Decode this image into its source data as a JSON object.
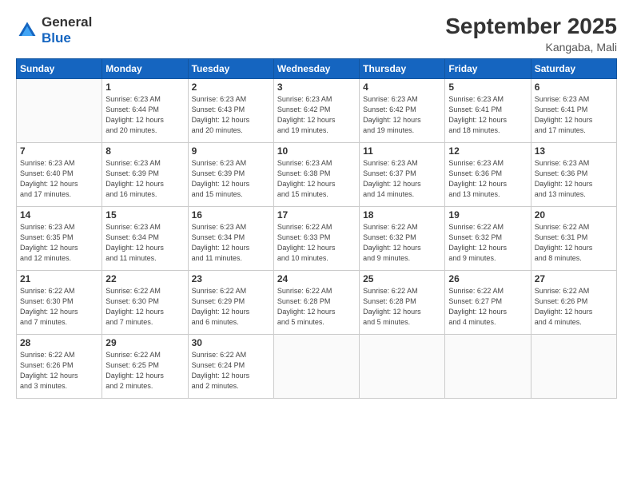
{
  "header": {
    "logo_general": "General",
    "logo_blue": "Blue",
    "title": "September 2025",
    "location": "Kangaba, Mali"
  },
  "weekdays": [
    "Sunday",
    "Monday",
    "Tuesday",
    "Wednesday",
    "Thursday",
    "Friday",
    "Saturday"
  ],
  "weeks": [
    [
      {
        "day": "",
        "info": ""
      },
      {
        "day": "1",
        "info": "Sunrise: 6:23 AM\nSunset: 6:44 PM\nDaylight: 12 hours\nand 20 minutes."
      },
      {
        "day": "2",
        "info": "Sunrise: 6:23 AM\nSunset: 6:43 PM\nDaylight: 12 hours\nand 20 minutes."
      },
      {
        "day": "3",
        "info": "Sunrise: 6:23 AM\nSunset: 6:42 PM\nDaylight: 12 hours\nand 19 minutes."
      },
      {
        "day": "4",
        "info": "Sunrise: 6:23 AM\nSunset: 6:42 PM\nDaylight: 12 hours\nand 19 minutes."
      },
      {
        "day": "5",
        "info": "Sunrise: 6:23 AM\nSunset: 6:41 PM\nDaylight: 12 hours\nand 18 minutes."
      },
      {
        "day": "6",
        "info": "Sunrise: 6:23 AM\nSunset: 6:41 PM\nDaylight: 12 hours\nand 17 minutes."
      }
    ],
    [
      {
        "day": "7",
        "info": "Sunrise: 6:23 AM\nSunset: 6:40 PM\nDaylight: 12 hours\nand 17 minutes."
      },
      {
        "day": "8",
        "info": "Sunrise: 6:23 AM\nSunset: 6:39 PM\nDaylight: 12 hours\nand 16 minutes."
      },
      {
        "day": "9",
        "info": "Sunrise: 6:23 AM\nSunset: 6:39 PM\nDaylight: 12 hours\nand 15 minutes."
      },
      {
        "day": "10",
        "info": "Sunrise: 6:23 AM\nSunset: 6:38 PM\nDaylight: 12 hours\nand 15 minutes."
      },
      {
        "day": "11",
        "info": "Sunrise: 6:23 AM\nSunset: 6:37 PM\nDaylight: 12 hours\nand 14 minutes."
      },
      {
        "day": "12",
        "info": "Sunrise: 6:23 AM\nSunset: 6:36 PM\nDaylight: 12 hours\nand 13 minutes."
      },
      {
        "day": "13",
        "info": "Sunrise: 6:23 AM\nSunset: 6:36 PM\nDaylight: 12 hours\nand 13 minutes."
      }
    ],
    [
      {
        "day": "14",
        "info": "Sunrise: 6:23 AM\nSunset: 6:35 PM\nDaylight: 12 hours\nand 12 minutes."
      },
      {
        "day": "15",
        "info": "Sunrise: 6:23 AM\nSunset: 6:34 PM\nDaylight: 12 hours\nand 11 minutes."
      },
      {
        "day": "16",
        "info": "Sunrise: 6:23 AM\nSunset: 6:34 PM\nDaylight: 12 hours\nand 11 minutes."
      },
      {
        "day": "17",
        "info": "Sunrise: 6:22 AM\nSunset: 6:33 PM\nDaylight: 12 hours\nand 10 minutes."
      },
      {
        "day": "18",
        "info": "Sunrise: 6:22 AM\nSunset: 6:32 PM\nDaylight: 12 hours\nand 9 minutes."
      },
      {
        "day": "19",
        "info": "Sunrise: 6:22 AM\nSunset: 6:32 PM\nDaylight: 12 hours\nand 9 minutes."
      },
      {
        "day": "20",
        "info": "Sunrise: 6:22 AM\nSunset: 6:31 PM\nDaylight: 12 hours\nand 8 minutes."
      }
    ],
    [
      {
        "day": "21",
        "info": "Sunrise: 6:22 AM\nSunset: 6:30 PM\nDaylight: 12 hours\nand 7 minutes."
      },
      {
        "day": "22",
        "info": "Sunrise: 6:22 AM\nSunset: 6:30 PM\nDaylight: 12 hours\nand 7 minutes."
      },
      {
        "day": "23",
        "info": "Sunrise: 6:22 AM\nSunset: 6:29 PM\nDaylight: 12 hours\nand 6 minutes."
      },
      {
        "day": "24",
        "info": "Sunrise: 6:22 AM\nSunset: 6:28 PM\nDaylight: 12 hours\nand 5 minutes."
      },
      {
        "day": "25",
        "info": "Sunrise: 6:22 AM\nSunset: 6:28 PM\nDaylight: 12 hours\nand 5 minutes."
      },
      {
        "day": "26",
        "info": "Sunrise: 6:22 AM\nSunset: 6:27 PM\nDaylight: 12 hours\nand 4 minutes."
      },
      {
        "day": "27",
        "info": "Sunrise: 6:22 AM\nSunset: 6:26 PM\nDaylight: 12 hours\nand 4 minutes."
      }
    ],
    [
      {
        "day": "28",
        "info": "Sunrise: 6:22 AM\nSunset: 6:26 PM\nDaylight: 12 hours\nand 3 minutes."
      },
      {
        "day": "29",
        "info": "Sunrise: 6:22 AM\nSunset: 6:25 PM\nDaylight: 12 hours\nand 2 minutes."
      },
      {
        "day": "30",
        "info": "Sunrise: 6:22 AM\nSunset: 6:24 PM\nDaylight: 12 hours\nand 2 minutes."
      },
      {
        "day": "",
        "info": ""
      },
      {
        "day": "",
        "info": ""
      },
      {
        "day": "",
        "info": ""
      },
      {
        "day": "",
        "info": ""
      }
    ]
  ]
}
